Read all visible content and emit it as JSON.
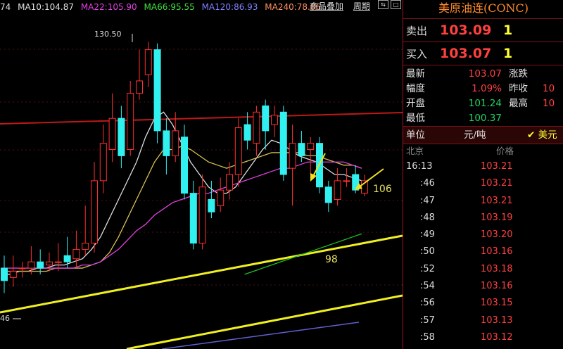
{
  "ma_bar": {
    "prefix": "74",
    "items": [
      {
        "label": "MA10:104.87",
        "color": "#e0e0e0"
      },
      {
        "label": "MA22:105.90",
        "color": "#e040e0"
      },
      {
        "label": "MA66:95.55",
        "color": "#40e040"
      },
      {
        "label": "MA120:86.93",
        "color": "#8080ff"
      },
      {
        "label": "MA240:78.86",
        "color": "#ff9060"
      }
    ]
  },
  "toolbar": {
    "btn1": "商品叠加",
    "btn2": "周期"
  },
  "chart_marks": {
    "high": "130.50",
    "low": "46"
  },
  "annotations": {
    "a106": "106",
    "a98": "98"
  },
  "chart_data": {
    "type": "candlestick",
    "candles": [
      {
        "o": 58,
        "c": 54,
        "h": 62,
        "l": 50
      },
      {
        "o": 55,
        "c": 57,
        "h": 62,
        "l": 52
      },
      {
        "o": 58,
        "c": 58,
        "h": 60,
        "l": 55
      },
      {
        "o": 58,
        "c": 60,
        "h": 65,
        "l": 56
      },
      {
        "o": 60,
        "c": 58,
        "h": 64,
        "l": 56
      },
      {
        "o": 59,
        "c": 60,
        "h": 63,
        "l": 57
      },
      {
        "o": 60,
        "c": 60,
        "h": 66,
        "l": 57
      },
      {
        "o": 62,
        "c": 60,
        "h": 68,
        "l": 58
      },
      {
        "o": 61,
        "c": 64,
        "h": 70,
        "l": 58
      },
      {
        "o": 64,
        "c": 66,
        "h": 78,
        "l": 62
      },
      {
        "o": 66,
        "c": 86,
        "h": 92,
        "l": 63
      },
      {
        "o": 86,
        "c": 98,
        "h": 104,
        "l": 82
      },
      {
        "o": 96,
        "c": 106,
        "h": 114,
        "l": 92
      },
      {
        "o": 106,
        "c": 94,
        "h": 110,
        "l": 90
      },
      {
        "o": 96,
        "c": 114,
        "h": 118,
        "l": 94
      },
      {
        "o": 114,
        "c": 118,
        "h": 128,
        "l": 112
      },
      {
        "o": 120,
        "c": 128,
        "h": 130.5,
        "l": 116
      },
      {
        "o": 128,
        "c": 102,
        "h": 130,
        "l": 98
      },
      {
        "o": 102,
        "c": 94,
        "h": 106,
        "l": 88
      },
      {
        "o": 94,
        "c": 102,
        "h": 108,
        "l": 92
      },
      {
        "o": 100,
        "c": 82,
        "h": 104,
        "l": 80
      },
      {
        "o": 82,
        "c": 66,
        "h": 86,
        "l": 64
      },
      {
        "o": 66,
        "c": 84,
        "h": 88,
        "l": 64
      },
      {
        "o": 80,
        "c": 76,
        "h": 86,
        "l": 74
      },
      {
        "o": 78,
        "c": 83,
        "h": 87,
        "l": 76
      },
      {
        "o": 83,
        "c": 88,
        "h": 92,
        "l": 80
      },
      {
        "o": 88,
        "c": 103,
        "h": 106,
        "l": 84
      },
      {
        "o": 104,
        "c": 99,
        "h": 108,
        "l": 96
      },
      {
        "o": 98,
        "c": 108,
        "h": 110,
        "l": 94
      },
      {
        "o": 110,
        "c": 102,
        "h": 112,
        "l": 96
      },
      {
        "o": 104,
        "c": 107,
        "h": 110,
        "l": 100
      },
      {
        "o": 108,
        "c": 88,
        "h": 110,
        "l": 86
      },
      {
        "o": 90,
        "c": 98,
        "h": 104,
        "l": 78
      },
      {
        "o": 98,
        "c": 94,
        "h": 102,
        "l": 92
      },
      {
        "o": 96,
        "c": 98,
        "h": 100,
        "l": 88
      },
      {
        "o": 98,
        "c": 84,
        "h": 100,
        "l": 82
      },
      {
        "o": 84,
        "c": 79,
        "h": 86,
        "l": 76
      },
      {
        "o": 80,
        "c": 86,
        "h": 90,
        "l": 78
      },
      {
        "o": 86,
        "c": 86,
        "h": 90,
        "l": 84
      },
      {
        "o": 88,
        "c": 83,
        "h": 91,
        "l": 82
      },
      {
        "o": 82,
        "c": 86,
        "h": 88,
        "l": 81
      }
    ],
    "ylim": [
      42,
      134
    ],
    "lines": [
      {
        "name": "MA10",
        "color": "#dcdcdc",
        "values": [
          56,
          56,
          57,
          57,
          58,
          58,
          59,
          59,
          60,
          61,
          64,
          68,
          74,
          80,
          86,
          92,
          100,
          106,
          108,
          104,
          98,
          92,
          88,
          84,
          82,
          82,
          84,
          88,
          92,
          96,
          99,
          98,
          96,
          94,
          93,
          92,
          90,
          88,
          88,
          87,
          86
        ]
      },
      {
        "name": "MA22",
        "color": "#d6c050",
        "values": [
          57,
          57,
          57,
          57,
          57,
          57,
          58,
          58,
          58,
          58,
          59,
          60,
          63,
          68,
          74,
          80,
          86,
          92,
          96,
          96,
          97,
          96,
          94,
          92,
          91,
          90,
          91,
          92,
          93,
          94,
          95,
          95,
          95,
          95,
          94,
          94,
          93,
          92,
          91,
          91,
          90
        ]
      },
      {
        "name": "MA66",
        "color": "#e040e0",
        "values": [
          58,
          58,
          58,
          58,
          58,
          58,
          58,
          58,
          58,
          59,
          59,
          60,
          62,
          64,
          67,
          70,
          72,
          75,
          77,
          79,
          80,
          81,
          82,
          82,
          83,
          84,
          85,
          86,
          87,
          88,
          89,
          90,
          90,
          91,
          92,
          92,
          92,
          92,
          92,
          91,
          90
        ]
      },
      {
        "name": "MA120",
        "color": "#20c020",
        "values": [
          null,
          null,
          null,
          null,
          null,
          null,
          null,
          null,
          null,
          null,
          null,
          null,
          null,
          null,
          null,
          null,
          null,
          null,
          null,
          null,
          null,
          null,
          null,
          null,
          null,
          null,
          null,
          56,
          57,
          58,
          59,
          60,
          61,
          62,
          63,
          64,
          65,
          66,
          67,
          68,
          69
        ]
      },
      {
        "name": "MA240",
        "color": "#7070e0",
        "values": []
      }
    ]
  },
  "panel": {
    "title": "美原油连(CONC)",
    "sell_label": "卖出",
    "sell_price": "103.09",
    "sell_qty": "1",
    "buy_label": "买入",
    "buy_price": "103.07",
    "buy_qty": "1",
    "stats": [
      {
        "k1": "最新",
        "v1": "103.07",
        "k2": "涨跌",
        "v2": ""
      },
      {
        "k1": "幅度",
        "v1": "1.09%",
        "k2": "昨收",
        "v2": "10"
      },
      {
        "k1": "开盘",
        "v1": "101.24",
        "k2": "最高",
        "v2": "10"
      },
      {
        "k1": "最低",
        "v1": "100.37",
        "k2": "",
        "v2": ""
      }
    ],
    "unit_label": "单位",
    "unit_value": "元/吨",
    "currency": "✔ 美元",
    "tick_header_left": "北京",
    "tick_header_right": "价格",
    "ticks": [
      {
        "t": "16:13",
        "p": "103.21"
      },
      {
        "t": ":46",
        "p": "103.21"
      },
      {
        "t": ":47",
        "p": "103.21"
      },
      {
        "t": ":48",
        "p": "103.19"
      },
      {
        "t": ":49",
        "p": "103.20"
      },
      {
        "t": ":50",
        "p": "103.16"
      },
      {
        "t": ":52",
        "p": "103.18"
      },
      {
        "t": ":54",
        "p": "103.16"
      },
      {
        "t": ":56",
        "p": "103.15"
      },
      {
        "t": ":57",
        "p": "103.13"
      },
      {
        "t": ":58",
        "p": "103.12"
      }
    ]
  }
}
